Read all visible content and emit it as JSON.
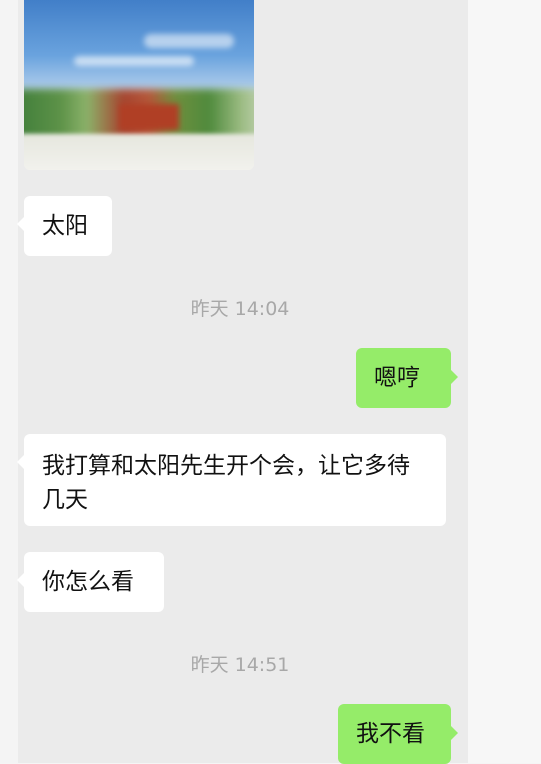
{
  "messages": [
    {
      "side": "left",
      "type": "image"
    },
    {
      "side": "left",
      "type": "text",
      "text": "太阳"
    },
    {
      "type": "timestamp",
      "text": "昨天 14:04"
    },
    {
      "side": "right",
      "type": "text",
      "text": "嗯哼"
    },
    {
      "side": "left",
      "type": "text",
      "text": "我打算和太阳先生开个会，让它多待几天"
    },
    {
      "side": "left",
      "type": "text",
      "text": "你怎么看"
    },
    {
      "type": "timestamp",
      "text": "昨天 14:51"
    },
    {
      "side": "right",
      "type": "text",
      "text": "我不看"
    }
  ],
  "colors": {
    "chat_background": "#ebebeb",
    "incoming_bubble": "#ffffff",
    "outgoing_bubble": "#95ec69",
    "timestamp_text": "#a8a8a8"
  }
}
